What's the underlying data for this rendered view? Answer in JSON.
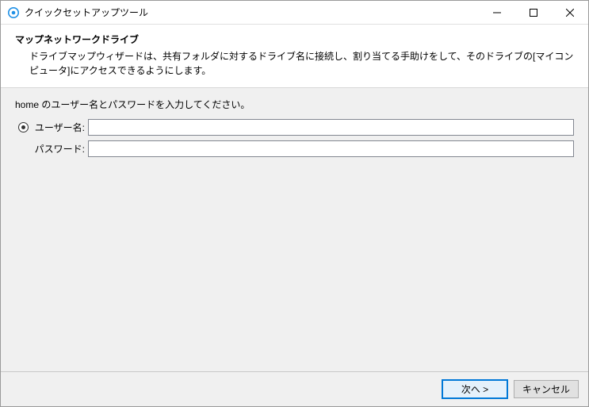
{
  "window": {
    "title": "クイックセットアップツール"
  },
  "header": {
    "heading": "マップネットワークドライブ",
    "description": "ドライブマップウィザードは、共有フォルダに対するドライブ名に接続し、割り当てる手助けをして、そのドライブの[マイコンピュータ]にアクセスできるようにします。"
  },
  "body": {
    "prompt": "home のユーザー名とパスワードを入力してください。",
    "username_label": "ユーザー名:",
    "username_value": "",
    "password_label": "パスワード:",
    "password_value": ""
  },
  "footer": {
    "next_label": "次へ >",
    "cancel_label": "キャンセル"
  }
}
